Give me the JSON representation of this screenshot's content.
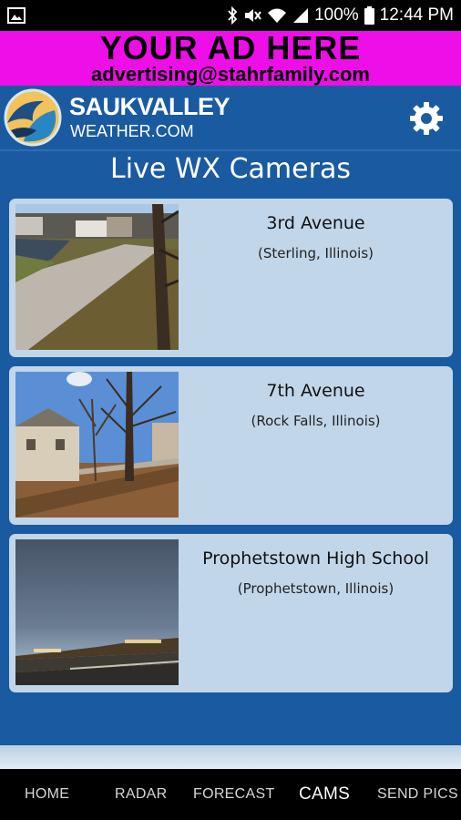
{
  "status_bar": {
    "battery": "100%",
    "time": "12:44 PM"
  },
  "ad": {
    "title": "YOUR AD HERE",
    "email": "advertising@stahrfamily.com"
  },
  "header": {
    "brand_top": "SAUKVALLEY",
    "brand_bottom": "WEATHER.COM"
  },
  "page_title": "Live WX Cameras",
  "cameras": [
    {
      "name": "3rd Avenue",
      "location": "(Sterling, Illinois)"
    },
    {
      "name": "7th Avenue",
      "location": "(Rock Falls, Illinois)"
    },
    {
      "name": "Prophetstown High School",
      "location": "(Prophetstown, Illinois)"
    }
  ],
  "nav": {
    "items": [
      {
        "label": "HOME"
      },
      {
        "label": "RADAR"
      },
      {
        "label": "FORECAST"
      },
      {
        "label": "CAMS"
      },
      {
        "label": "SEND PICS"
      }
    ],
    "active": "CAMS"
  },
  "colors": {
    "background": "#1a5aa0",
    "ad_banner": "#ee0ee8",
    "card": "#c2d6e9"
  }
}
